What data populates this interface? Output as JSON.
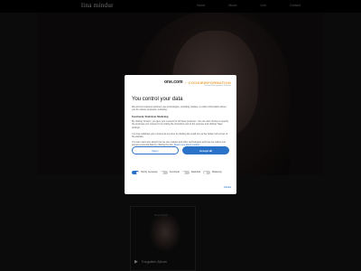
{
  "brand": "lina mindur",
  "nav": [
    "Home",
    "Music",
    "Live",
    "Contact"
  ],
  "section_title": "DISCOGRAPHY",
  "album": {
    "tiny_label": "lina mindur",
    "title": "Forgotten Album",
    "play_glyph": "▶"
  },
  "dialog": {
    "logo_one": "one.com",
    "logo_plus": "+",
    "logo_cookie": "COOKIEINFORMATION",
    "logo_sub": "Consent Management Platform",
    "title": "You control your data",
    "intro": "We and our business partners use technologies, including cookies, to collect information about you for various purposes, including:",
    "purposes": "Functional, Statistical, Marketing",
    "body": "By clicking 'Accept', you give your consent for all these purposes. You can also choose to specify the purposes you consent to by ticking the checkbox next to the purpose and clicking 'Save settings'.",
    "withdraw": "You may withdraw your consent at any time by clicking the small icon at the bottom left corner of the website.",
    "more": "You can read more about how we use cookies and other technologies and how we collect and process personal data by clicking the link.",
    "read_more": "Read more about cookies",
    "deny_label": "Deny",
    "accept_label": "Accept all",
    "toggles": [
      {
        "label": "Strictly necessary",
        "on": true
      },
      {
        "label": "Functional",
        "on": false
      },
      {
        "label": "Statistical",
        "on": false
      },
      {
        "label": "Marketing",
        "on": false
      }
    ],
    "details_label": "Details"
  }
}
